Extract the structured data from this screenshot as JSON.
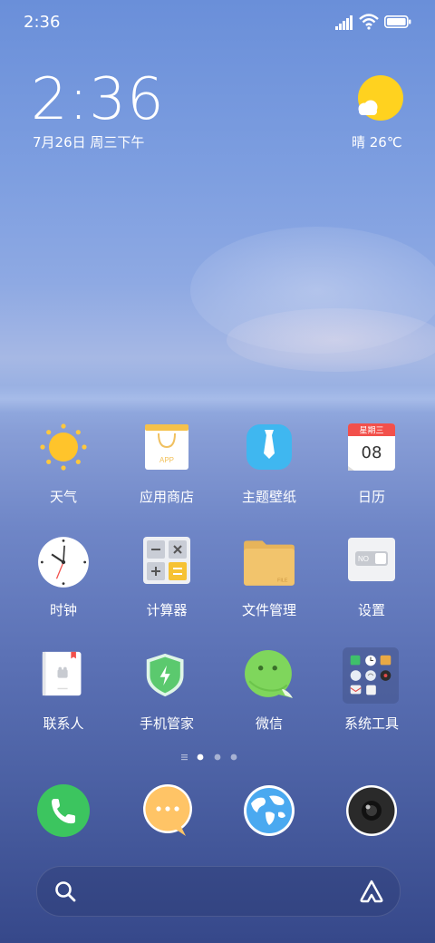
{
  "status_bar": {
    "time": "2:36"
  },
  "clock_widget": {
    "time": "2:36",
    "date": "7月26日 周三下午"
  },
  "weather_widget": {
    "text": "晴 26℃"
  },
  "apps": [
    {
      "label": "天气",
      "icon": "sun-icon"
    },
    {
      "label": "应用商店",
      "icon": "shopping-bag-icon"
    },
    {
      "label": "主题壁纸",
      "icon": "shirt-tie-icon"
    },
    {
      "label": "日历",
      "icon": "calendar-icon",
      "calendar_weekday": "星期三",
      "calendar_day": "08"
    },
    {
      "label": "时钟",
      "icon": "clock-icon"
    },
    {
      "label": "计算器",
      "icon": "calculator-icon"
    },
    {
      "label": "文件管理",
      "icon": "folder-icon"
    },
    {
      "label": "设置",
      "icon": "toggle-switch-icon"
    },
    {
      "label": "联系人",
      "icon": "contacts-book-icon"
    },
    {
      "label": "手机管家",
      "icon": "shield-bolt-icon"
    },
    {
      "label": "微信",
      "icon": "chat-bubble-icon"
    },
    {
      "label": "系统工具",
      "icon": "folder-grid-icon"
    }
  ],
  "dock": [
    {
      "name": "phone",
      "icon": "phone-icon",
      "color": "#3cc55f"
    },
    {
      "name": "messages",
      "icon": "message-bubble-icon",
      "color": "#ffc466"
    },
    {
      "name": "browser",
      "icon": "globe-icon",
      "color": "#4aa9f0"
    },
    {
      "name": "camera",
      "icon": "camera-icon",
      "color": "#2a2a2a"
    }
  ],
  "page_indicator": {
    "pages": 3,
    "current": 1
  },
  "labels_icons": {
    "store_text": "APP",
    "settings_toggle": "NO",
    "file_tag": "FILE"
  }
}
